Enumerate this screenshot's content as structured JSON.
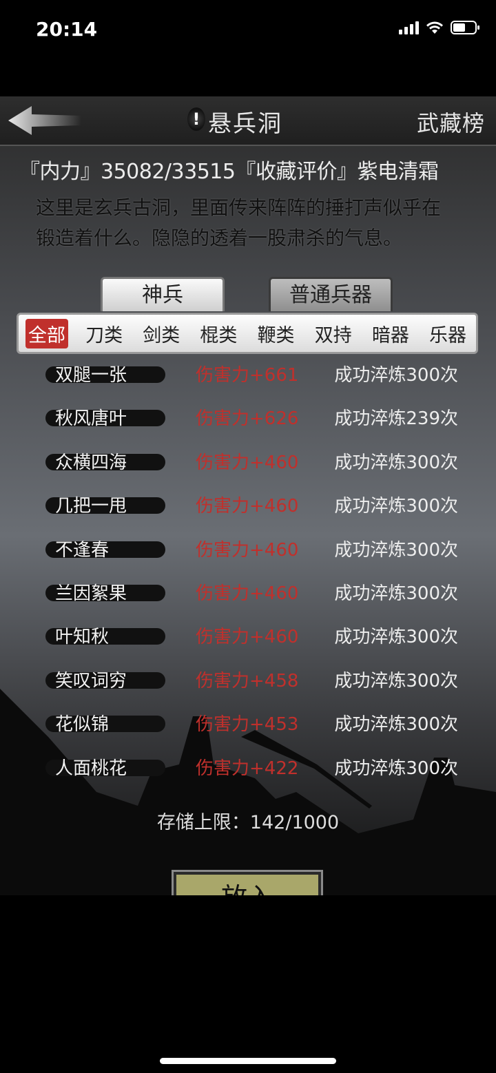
{
  "status_bar": {
    "time": "20:14"
  },
  "header": {
    "title": "悬兵洞",
    "rank_button": "武藏榜"
  },
  "info": {
    "line": "『内力』35082/33515『收藏评价』紫电清霜"
  },
  "description": "这里是玄兵古洞，里面传来阵阵的捶打声似乎在锻造着什么。隐隐的透着一股肃杀的气息。",
  "tabs": [
    {
      "label": "神兵",
      "active": true
    },
    {
      "label": "普通兵器",
      "active": false
    }
  ],
  "filters": [
    {
      "label": "全部",
      "active": true
    },
    {
      "label": "刀类"
    },
    {
      "label": "剑类"
    },
    {
      "label": "棍类"
    },
    {
      "label": "鞭类"
    },
    {
      "label": "双持"
    },
    {
      "label": "暗器"
    },
    {
      "label": "乐器"
    }
  ],
  "weapons": [
    {
      "name": "双腿一张",
      "damage": "伤害力+661",
      "temper": "成功淬炼300次"
    },
    {
      "name": "秋风唐叶",
      "damage": "伤害力+626",
      "temper": "成功淬炼239次"
    },
    {
      "name": "众横四海",
      "damage": "伤害力+460",
      "temper": "成功淬炼300次"
    },
    {
      "name": "几把一甩",
      "damage": "伤害力+460",
      "temper": "成功淬炼300次"
    },
    {
      "name": "不逢春",
      "damage": "伤害力+460",
      "temper": "成功淬炼300次"
    },
    {
      "name": "兰因絮果",
      "damage": "伤害力+460",
      "temper": "成功淬炼300次"
    },
    {
      "name": "叶知秋",
      "damage": "伤害力+460",
      "temper": "成功淬炼300次"
    },
    {
      "name": "笑叹词穷",
      "damage": "伤害力+458",
      "temper": "成功淬炼300次"
    },
    {
      "name": "花似锦",
      "damage": "伤害力+453",
      "temper": "成功淬炼300次"
    },
    {
      "name": "人面桃花",
      "damage": "伤害力+422",
      "temper": "成功淬炼300次"
    }
  ],
  "storage": "存储上限：142/1000",
  "put_button": "放入",
  "colors": {
    "accent_red": "#c0302c",
    "button_olive": "#a9a76a"
  }
}
